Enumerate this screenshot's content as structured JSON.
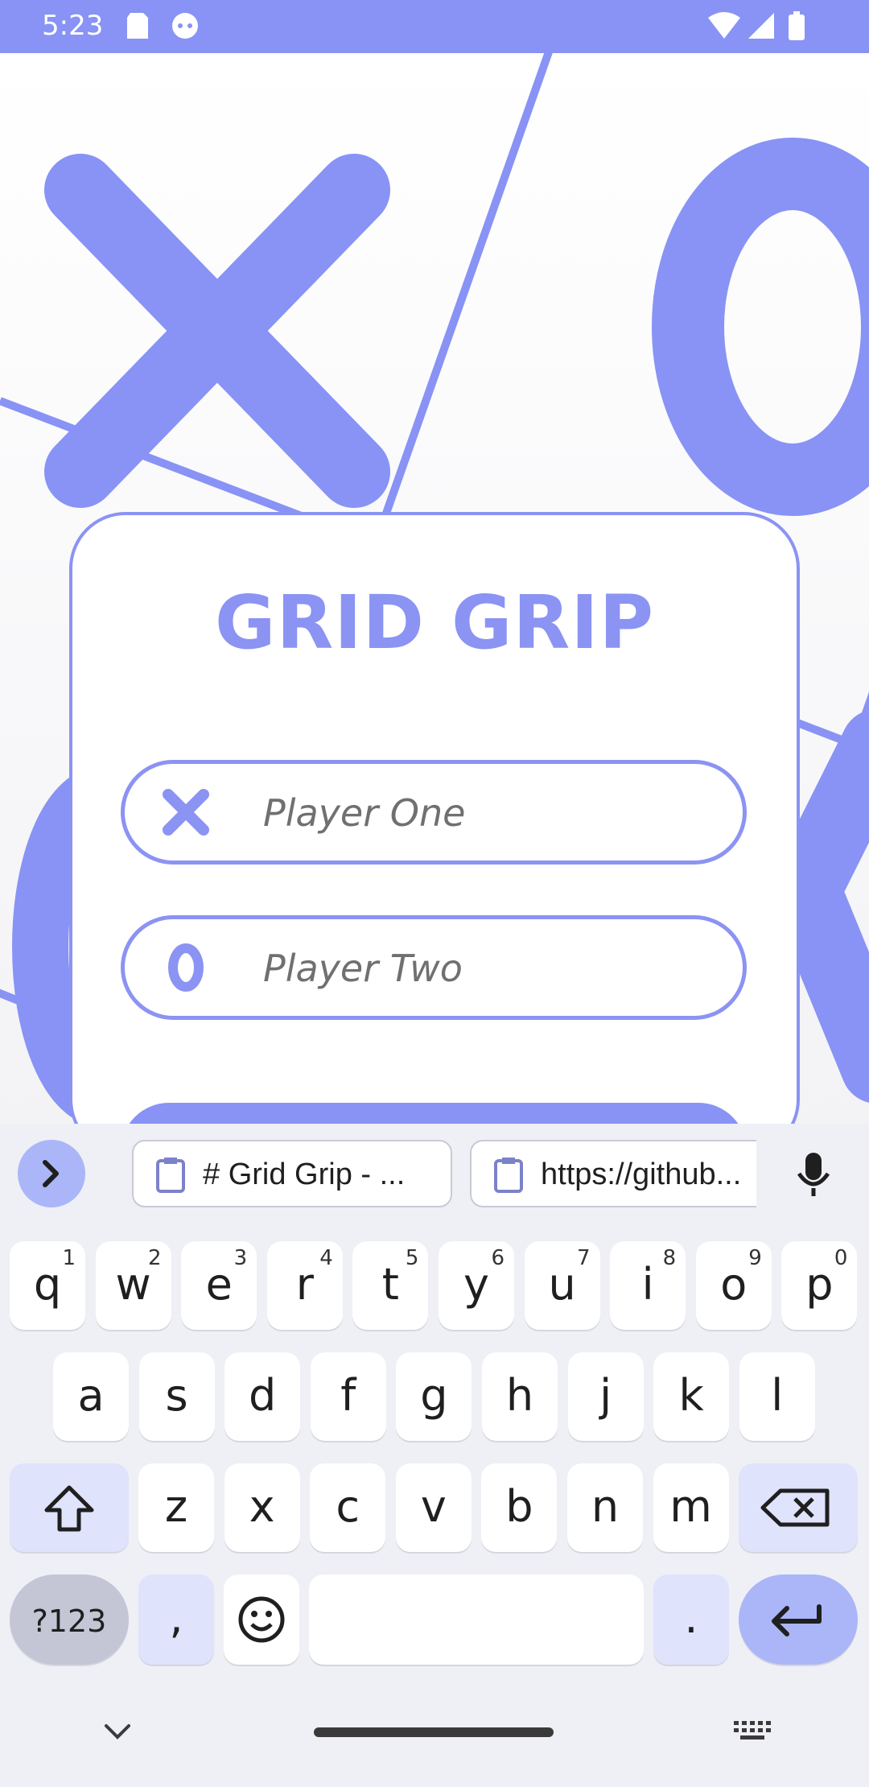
{
  "status": {
    "time": "5:23"
  },
  "app": {
    "title": "GRID GRIP",
    "player_one_placeholder": "Player One",
    "player_two_placeholder": "Player Two"
  },
  "keyboard": {
    "suggestions": [
      "# Grid Grip - ...",
      "https://github..."
    ],
    "row1": [
      {
        "k": "q",
        "n": "1"
      },
      {
        "k": "w",
        "n": "2"
      },
      {
        "k": "e",
        "n": "3"
      },
      {
        "k": "r",
        "n": "4"
      },
      {
        "k": "t",
        "n": "5"
      },
      {
        "k": "y",
        "n": "6"
      },
      {
        "k": "u",
        "n": "7"
      },
      {
        "k": "i",
        "n": "8"
      },
      {
        "k": "o",
        "n": "9"
      },
      {
        "k": "p",
        "n": "0"
      }
    ],
    "row2": [
      "a",
      "s",
      "d",
      "f",
      "g",
      "h",
      "j",
      "k",
      "l"
    ],
    "row3": [
      "z",
      "x",
      "c",
      "v",
      "b",
      "n",
      "m"
    ],
    "sym_label": "?123",
    "comma": ",",
    "period": "."
  },
  "colors": {
    "accent": "#8b93f3",
    "status": "#8893f5"
  }
}
